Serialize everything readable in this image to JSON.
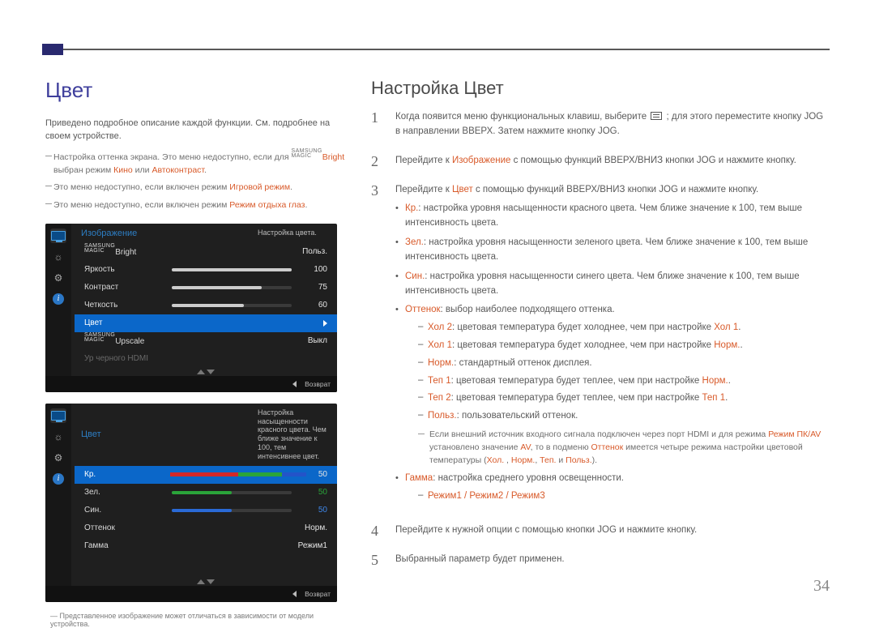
{
  "left": {
    "heading": "Цвет",
    "intro": "Приведено подробное описание каждой функции. См. подробнее на своем устройстве.",
    "notes": {
      "n1_a": "Настройка оттенка экрана. Это меню недоступно, если для ",
      "n1_brand": "SAMSUNG MAGIC",
      "n1_bright": "Bright",
      "n1_b": " выбран режим ",
      "n1_k": "Кино",
      "n1_or": " или ",
      "n1_ak": "Автоконтраст",
      "n2_a": "Это меню недоступно, если включен режим ",
      "n2_hl": "Игровой режим",
      "n3_a": "Это меню недоступно, если включен режим ",
      "n3_hl": "Режим отдыха глаз"
    },
    "footnote": "Представленное изображение может отличаться в зависимости от модели устройства."
  },
  "osd1": {
    "title": "Изображение",
    "desc": "Настройка цвета.",
    "rows": {
      "bright_label": "Bright",
      "bright_val": "Польз.",
      "brightness_label": "Яркость",
      "brightness_val": "100",
      "contrast_label": "Контраст",
      "contrast_val": "75",
      "sharpness_label": "Четкость",
      "sharpness_val": "60",
      "color_label": "Цвет",
      "upscale_label": "Upscale",
      "upscale_val": "Выкл",
      "hdmi_label": "Ур черного HDMI"
    },
    "footer_return": "Возврат"
  },
  "osd2": {
    "title": "Цвет",
    "desc": "Настройка насыщенности красного цвета. Чем ближе значение к 100, тем интенсивнее цвет.",
    "rows": {
      "r_label": "Кр.",
      "r_val": "50",
      "g_label": "Зел.",
      "g_val": "50",
      "b_label": "Син.",
      "b_val": "50",
      "tone_label": "Оттенок",
      "tone_val": "Норм.",
      "gamma_label": "Гамма",
      "gamma_val": "Режим1"
    },
    "footer_return": "Возврат"
  },
  "right": {
    "heading": "Настройка Цвет",
    "step1_a": "Когда появится меню функциональных клавиш, выберите ",
    "step1_b": " ; для этого переместите кнопку JOG в направлении ВВЕРХ. Затем нажмите кнопку JOG.",
    "step2_a": "Перейдите к ",
    "step2_hl": "Изображение",
    "step2_b": " с помощью функций ВВЕРХ/ВНИЗ кнопки JOG и нажмите кнопку.",
    "step3_a": "Перейдите к ",
    "step3_hl": "Цвет",
    "step3_b": " с помощью функций ВВЕРХ/ВНИЗ кнопки JOG и нажмите кнопку.",
    "bullets": {
      "kr_l": "Кр.",
      "kr_t": ": настройка уровня насыщенности красного цвета. Чем ближе значение к 100, тем выше интенсивность цвета.",
      "zel_l": "Зел.",
      "zel_t": ": настройка уровня насыщенности зеленого цвета. Чем ближе значение к 100, тем выше интенсивность цвета.",
      "sin_l": "Син.",
      "sin_t": ": настройка уровня насыщенности синего цвета. Чем ближе значение к 100, тем выше интенсивность цвета.",
      "tone_l": "Оттенок",
      "tone_t": ": выбор наиболее подходящего оттенка.",
      "tone_d1_l": "Хол 2",
      "tone_d1_t": ": цветовая температура будет холоднее, чем при настройке ",
      "tone_d1_h": "Хол 1",
      "tone_d2_l": "Хол 1",
      "tone_d2_t": ": цветовая температура будет холоднее, чем при настройке ",
      "tone_d2_h": "Норм.",
      "tone_d3_l": "Норм.",
      "tone_d3_t": ": стандартный оттенок дисплея.",
      "tone_d4_l": "Теп 1",
      "tone_d4_t": ": цветовая температура будет теплее, чем при настройке ",
      "tone_d4_h": "Норм.",
      "tone_d5_l": "Теп 2",
      "tone_d5_t": ": цветовая температура будет теплее, чем при настройке ",
      "tone_d5_h": "Теп 1",
      "tone_d6_l": "Польз.",
      "tone_d6_t": ": пользовательский оттенок.",
      "ext_a": "Если внешний источник входного сигнала подключен через порт HDMI и для режима ",
      "ext_h1": "Режим ПК/AV",
      "ext_b": " установлено значение ",
      "ext_h2": "AV",
      "ext_c": ", то в подменю ",
      "ext_h3": "Оттенок",
      "ext_d": " имеется четыре режима настройки цветовой температуры (",
      "ext_h4": "Хол.",
      "ext_sep1": " , ",
      "ext_h5": "Норм.",
      "ext_sep2": ", ",
      "ext_h6": "Теп.",
      "ext_sep3": " и ",
      "ext_h7": "Польз.",
      "ext_e": ").",
      "gamma_l": "Гамма",
      "gamma_t": ": настройка среднего уровня освещенности.",
      "gamma_d": "Режим1 / Режим2 / Режим3"
    },
    "step4": "Перейдите к нужной опции с помощью кнопки JOG и нажмите кнопку.",
    "step5": "Выбранный параметр будет применен."
  },
  "page_number": "34"
}
